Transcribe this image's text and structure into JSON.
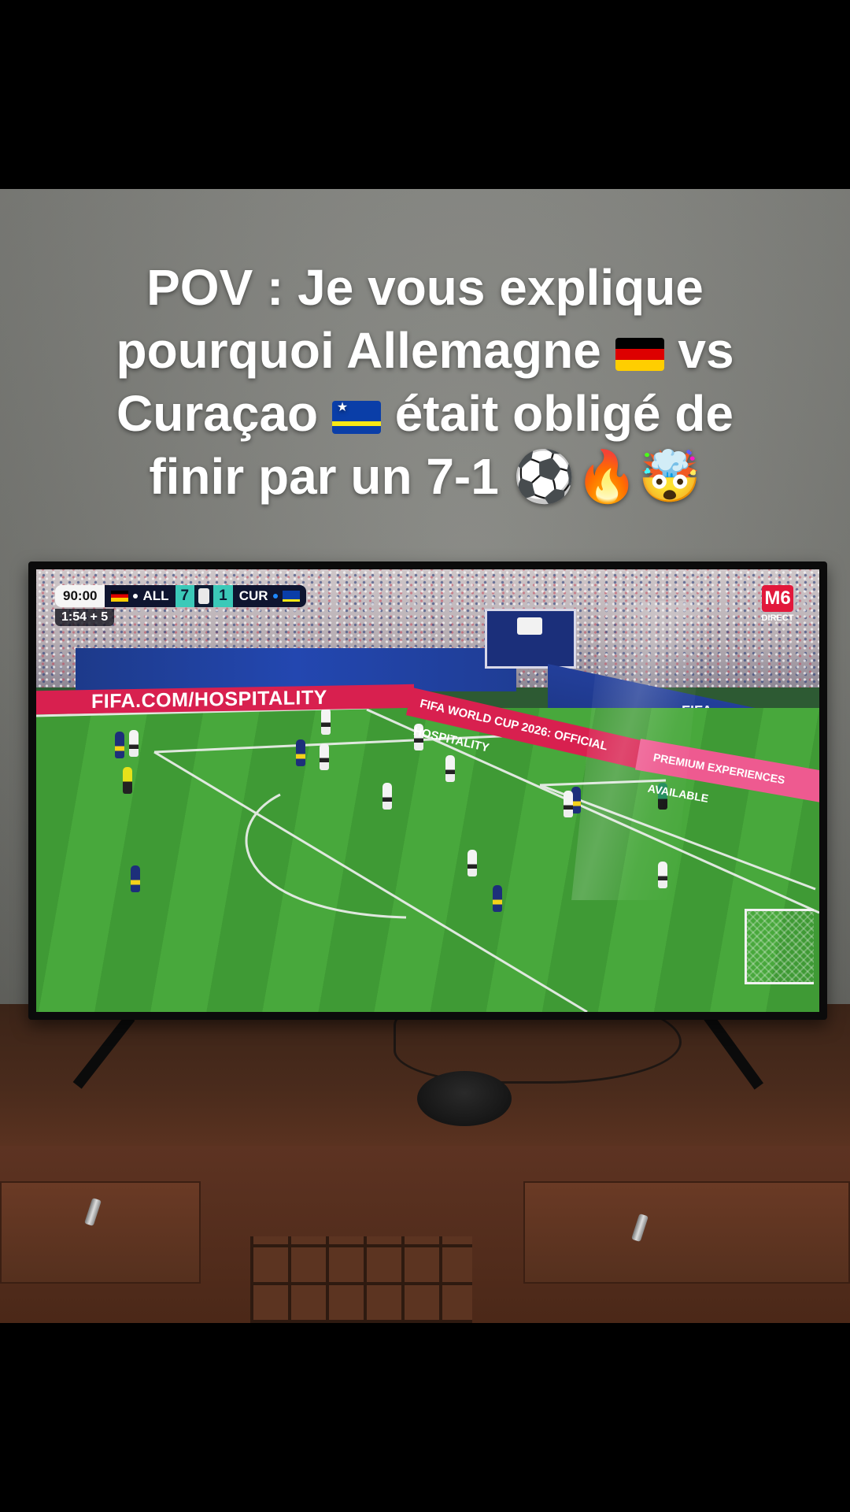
{
  "caption": {
    "line1": "POV : Je vous explique",
    "line2": "pourquoi Allemagne",
    "line2_end": "vs",
    "line3": "Curaçao",
    "line3_end": "était obligé de",
    "line4": "finir par un 7-1 ⚽🔥🤯"
  },
  "broadcast": {
    "clock": "90:00",
    "home_team": "ALL",
    "home_score": "7",
    "away_score": "1",
    "away_team": "CUR",
    "added_time": "1:54 + 5",
    "channel_logo": "M6",
    "channel_sub": "DIRECT"
  },
  "stadium": {
    "ad_board_1": "FIFA.COM/HOSPITALITY",
    "ad_board_2": "FIFA WORLD CUP 2026: OFFICIAL HOSPITALITY",
    "ad_board_3": "PREMIUM EXPERIENCES AVAILABLE",
    "wall_label": "FIFA"
  },
  "colors": {
    "germany": [
      "#000000",
      "#dd0000",
      "#ffce00"
    ],
    "curacao": [
      "#0a3ea8",
      "#f9e814"
    ],
    "score_accent": "#3bc9b8",
    "ad_red": "#d8204f"
  }
}
